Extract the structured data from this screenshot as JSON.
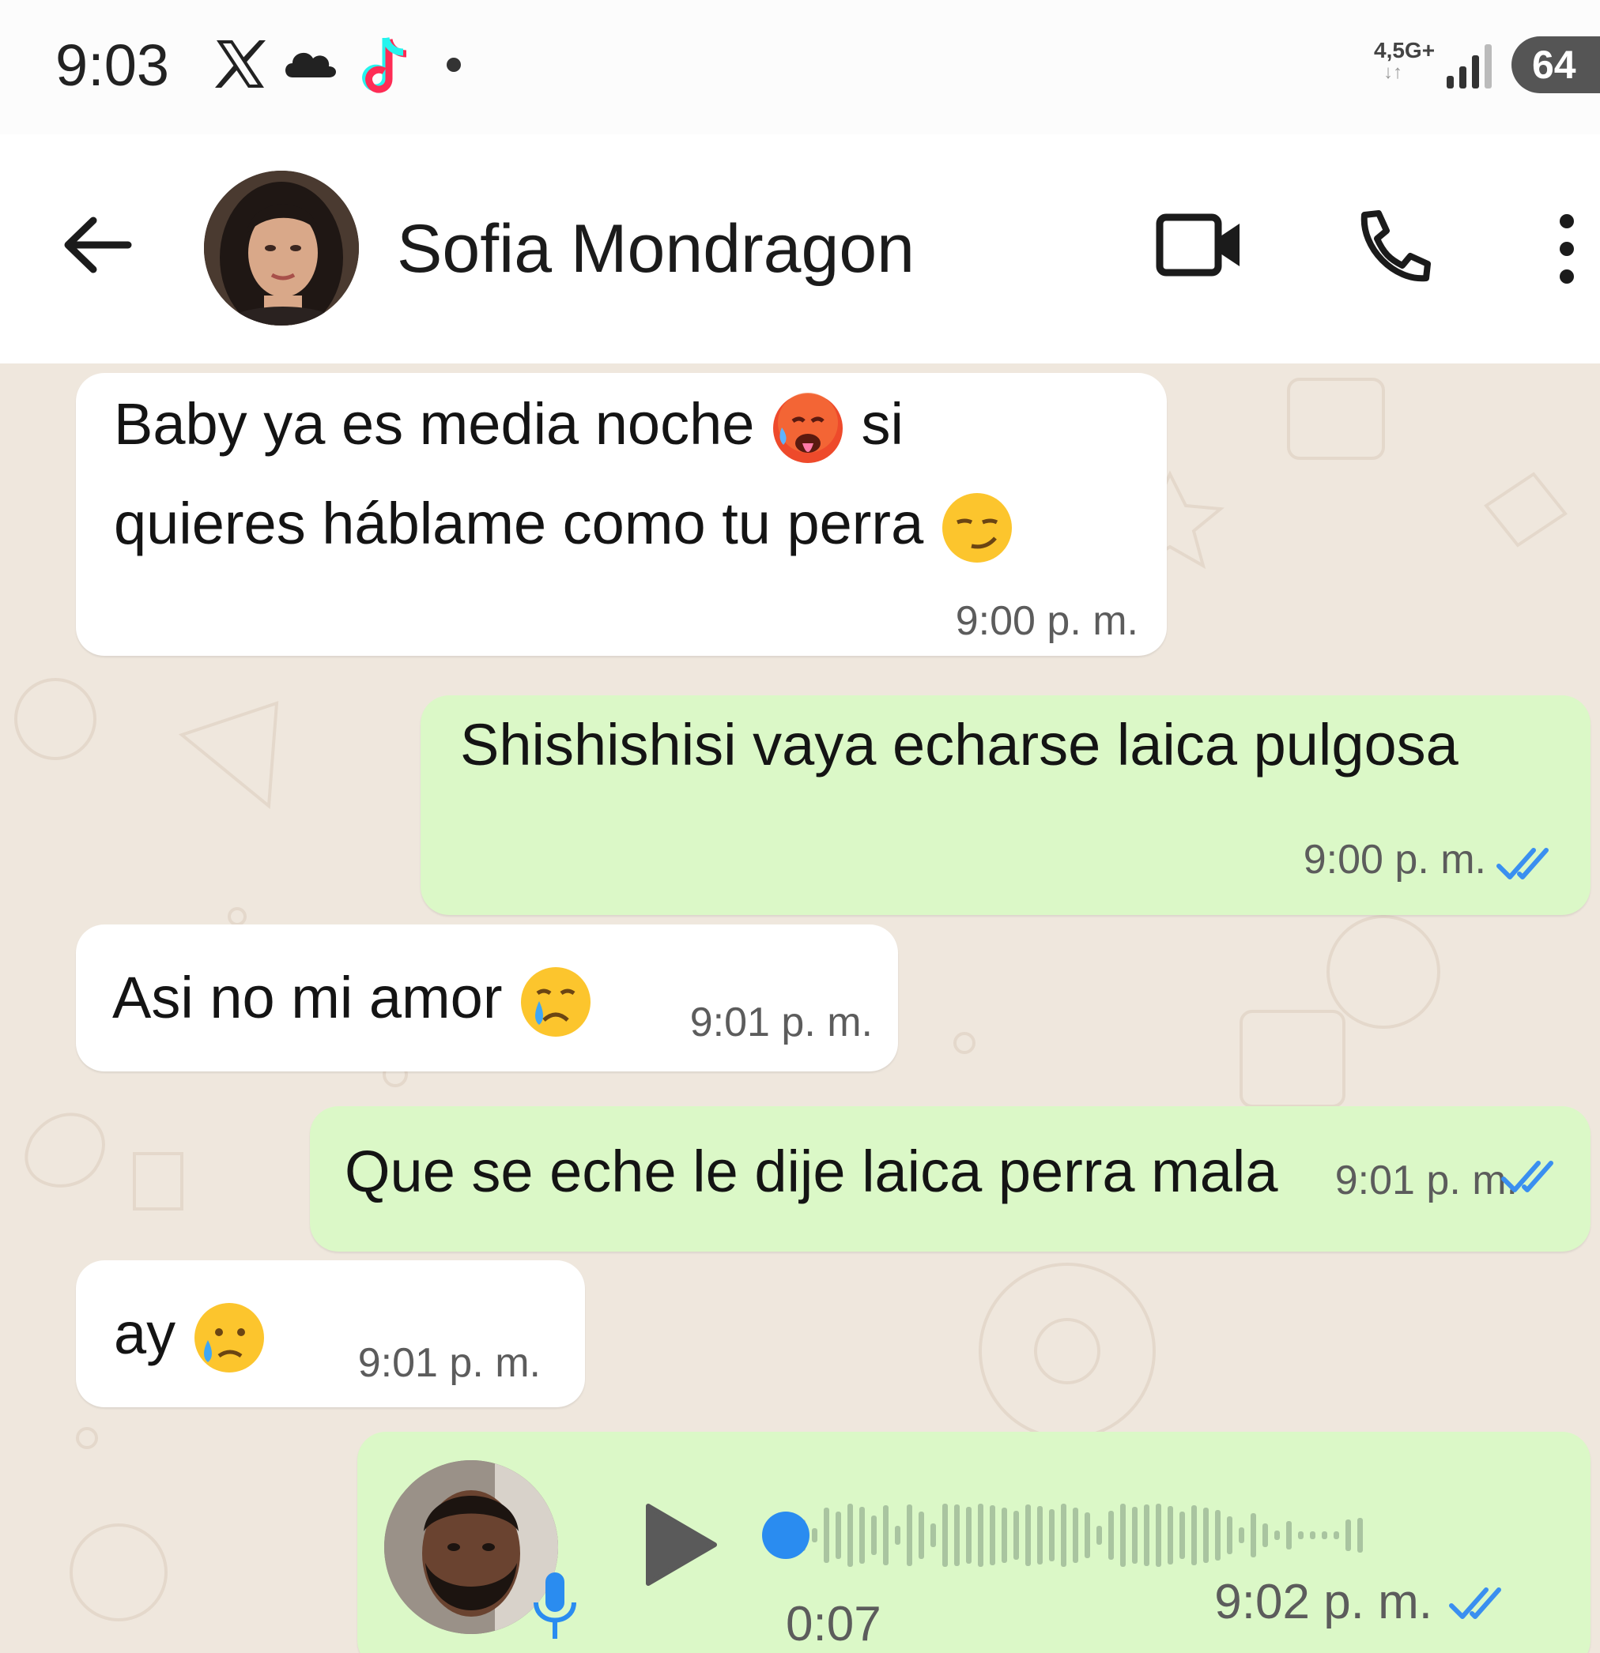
{
  "status_bar": {
    "time": "9:03",
    "icons": [
      "x-logo-icon",
      "cloud-icon",
      "tiktok-icon",
      "notification-dot-icon"
    ],
    "network": "4,5G+",
    "network_arrows": "↓↑",
    "battery": "64"
  },
  "header": {
    "contact_name": "Sofia Mondragon",
    "icons": [
      "back-arrow-icon",
      "video-call-icon",
      "phone-icon",
      "more-vert-icon"
    ]
  },
  "messages": [
    {
      "direction": "incoming",
      "lines": [
        {
          "parts": [
            "Baby ya es media noche ",
            " si"
          ],
          "emojis": [
            "hot-face-emoji"
          ]
        },
        {
          "parts": [
            "quieres háblame como tu perra "
          ],
          "emojis": [
            "smirk-emoji"
          ]
        }
      ],
      "time": "9:00 p. m."
    },
    {
      "direction": "outgoing",
      "text": "Shishishisi vaya echarse laica pulgosa",
      "time": "9:00 p. m.",
      "status": "read-ticks-icon"
    },
    {
      "direction": "incoming",
      "text": "Asi no mi amor ",
      "emoji": "crying-face-emoji",
      "time": "9:01 p. m."
    },
    {
      "direction": "outgoing",
      "text": "Que se eche le dije laica perra mala",
      "time": "9:01 p. m.",
      "status": "read-ticks-icon"
    },
    {
      "direction": "incoming",
      "text": "ay ",
      "emoji": "sad-tear-emoji",
      "time": "9:01 p. m."
    },
    {
      "direction": "outgoing",
      "type": "voice",
      "duration": "0:07",
      "played_fraction": 0.0,
      "time": "9:02 p. m.",
      "status": "read-ticks-icon"
    }
  ],
  "colors": {
    "incoming_bubble": "#ffffff",
    "outgoing_bubble": "#dbf8c7",
    "chat_background": "#efe7dd",
    "read_ticks": "#3a8ff0",
    "voice_progress_dot": "#2a8cf0"
  }
}
